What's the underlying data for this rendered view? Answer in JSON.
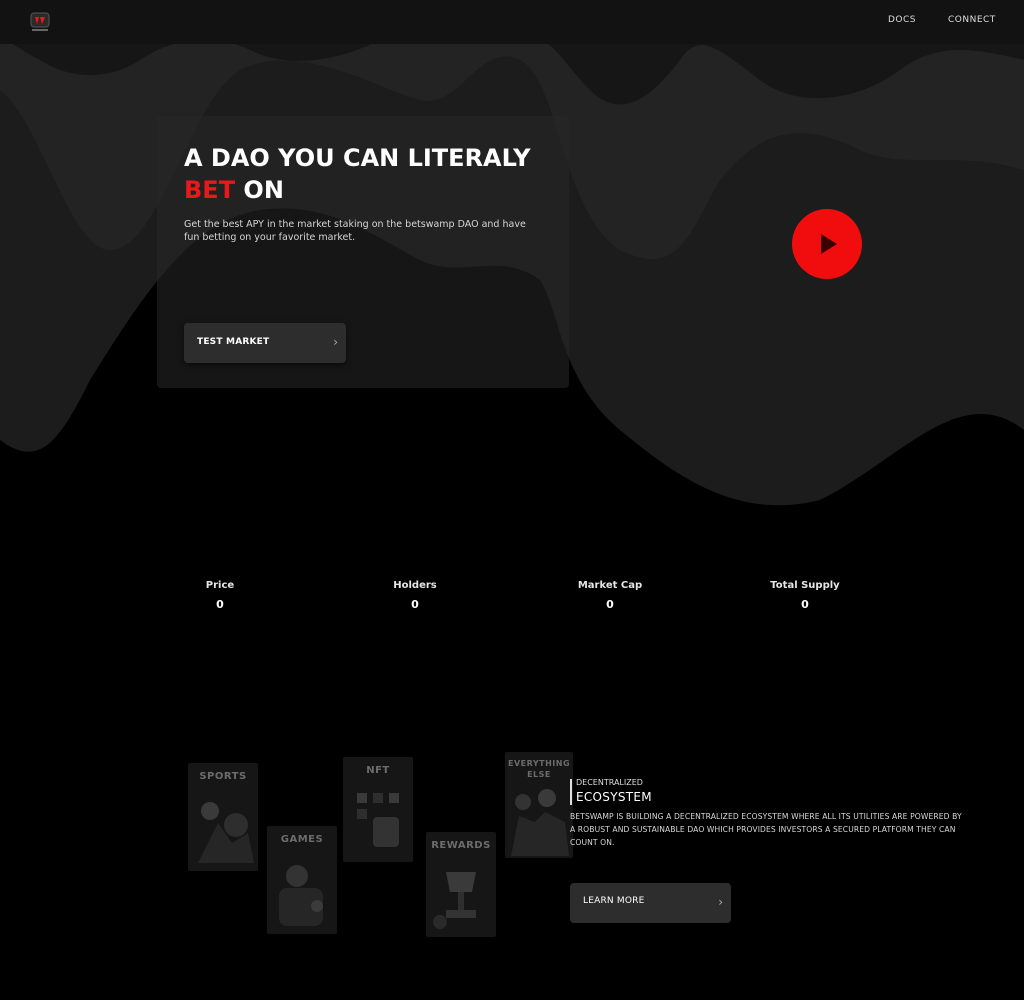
{
  "nav": {
    "docs_label": "DOCS",
    "connect_label": "CONNECT"
  },
  "hero": {
    "title_line1": "A DAO YOU CAN LITERALY",
    "title_accent": "BET",
    "title_line2_rest": " ON",
    "description": "Get the best APY in the market staking on the betswamp DAO and have fun betting on your favorite market.",
    "button_label": "TEST MARKET",
    "accent_color": "#e81919"
  },
  "stats": [
    {
      "label": "Price",
      "value": "0"
    },
    {
      "label": "Holders",
      "value": "0"
    },
    {
      "label": "Market Cap",
      "value": "0"
    },
    {
      "label": "Total Supply",
      "value": "0"
    }
  ],
  "ecosystem": {
    "cards": [
      "SPORTS",
      "GAMES",
      "NFT",
      "REWARDS",
      "EVERYTHING ELSE"
    ],
    "kicker": "DECENTRALIZED",
    "title": "ECOSYSTEM",
    "description": "BETSWAMP IS BUILDING A DECENTRALIZED ECOSYSTEM WHERE ALL ITS UTILITIES ARE POWERED BY A ROBUST AND SUSTAINABLE DAO WHICH PROVIDES INVESTORS A SECURED PLATFORM THEY CAN COUNT ON.",
    "button_label": "LEARN MORE"
  },
  "icons": {
    "logo": "betswamp-logo",
    "play": "play-icon",
    "chevron": "chevron-right-icon"
  }
}
